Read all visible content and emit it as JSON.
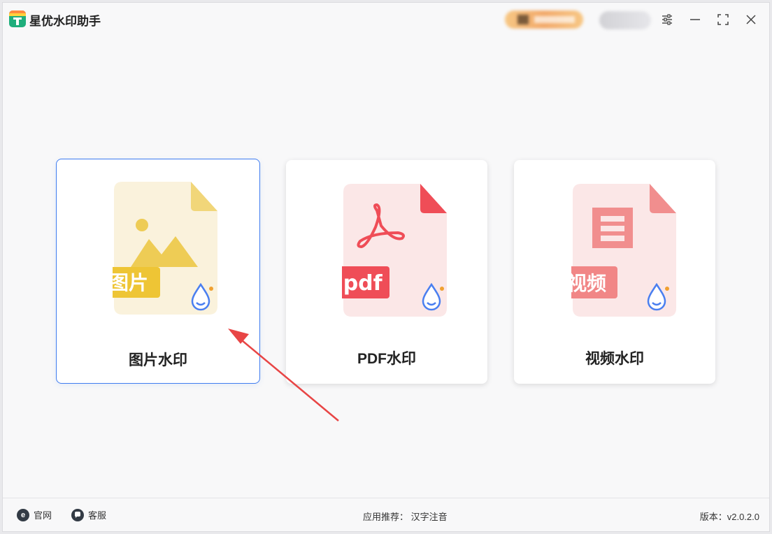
{
  "app": {
    "title": "星优水印助手"
  },
  "titlebar": {
    "icons": [
      "settings-sliders-icon",
      "minimize-icon",
      "maximize-icon",
      "close-icon"
    ]
  },
  "cards": [
    {
      "label": "图片水印",
      "badge": "图片",
      "color": "#eecc55",
      "selected": true
    },
    {
      "label": "PDF水印",
      "badge": ".pdf",
      "color": "#ef4d57",
      "selected": false
    },
    {
      "label": "视频水印",
      "badge": "视频",
      "color": "#ef8686",
      "selected": false
    }
  ],
  "footer": {
    "website": "官网",
    "support": "客服",
    "recommend_prefix": "应用推荐：",
    "recommend_app": "汉字注音",
    "version_label": "版本：",
    "version_value": "v2.0.2.0"
  },
  "colors": {
    "accent": "#3f7cf0",
    "arrow": "#e84545"
  }
}
